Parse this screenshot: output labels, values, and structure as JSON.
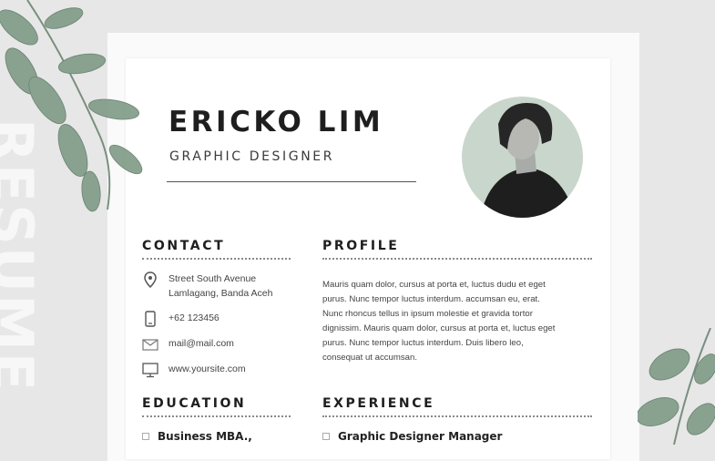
{
  "background_word": "RESUME",
  "header": {
    "name": "ERICKO LIM",
    "job_title": "GRAPHIC DESIGNER"
  },
  "contact": {
    "heading": "CONTACT",
    "address_line1": "Street  South Avenue",
    "address_line2": "Lamlagang, Banda Aceh",
    "phone": "+62 123456",
    "email": "mail@mail.com",
    "website": "www.yoursite.com",
    "icons": [
      "map-pin-icon",
      "phone-icon",
      "envelope-icon",
      "monitor-icon"
    ]
  },
  "profile": {
    "heading": "PROFILE",
    "lines": [
      "Mauris quam dolor, cursus at porta et, luctus dudu et eget",
      "purus. Nunc tempor luctus interdum. accumsan eu, erat.",
      "Nunc rhoncus tellus in ipsum molestie et gravida tortor",
      "dignissim. Mauris quam dolor, cursus at porta et, luctus eget",
      "purus. Nunc tempor luctus interdum. Duis libero leo,",
      "consequat ut accumsan."
    ]
  },
  "education": {
    "heading": "EDUCATION",
    "items": [
      "Business MBA.,"
    ]
  },
  "experience": {
    "heading": "EXPERIENCE",
    "items": [
      "Graphic Designer Manager"
    ]
  },
  "colors": {
    "leaf": "#7f9a86",
    "leaf_dark": "#5f7a68",
    "photo_bg": "#c9d6cc",
    "text_dark": "#1e1e1e"
  }
}
